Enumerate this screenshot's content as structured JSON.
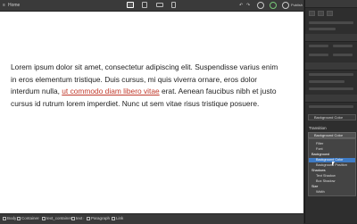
{
  "toolbar": {
    "left_label": "Home",
    "devices": [
      "desktop-icon",
      "tablet-icon",
      "phone-landscape-icon",
      "phone-icon"
    ],
    "right_label": "Publish"
  },
  "paragraph": {
    "before": "Lorem ipsum dolor sit amet, consectetur adipiscing elit. Suspendisse varius enim in eros elementum tristique. Duis cursus, mi quis viverra ornare, eros dolor interdum nulla, ",
    "link": "ut commodo diam libero vitae",
    "after": " erat. Aenean faucibus nibh et justo cursus id rutrum lorem imperdiet. Nunc ut sem vitae risus tristique posuere.",
    "link_color": "#c0392b"
  },
  "breadcrumb": {
    "items": [
      "Body",
      "Container",
      "text_container",
      "text",
      "Paragraph",
      "Link"
    ]
  },
  "panel": {
    "background_color_row": "Background Color",
    "transition_label": "Transition",
    "transition_value": "Background Color",
    "dropdown": [
      {
        "label": "Filter",
        "kind": "item"
      },
      {
        "label": "Font",
        "kind": "item"
      },
      {
        "label": "Background",
        "kind": "group"
      },
      {
        "label": "Background Color",
        "kind": "selected"
      },
      {
        "label": "Background Position",
        "kind": "item"
      },
      {
        "label": "Shadows",
        "kind": "group"
      },
      {
        "label": "Text Shadow",
        "kind": "item"
      },
      {
        "label": "Box Shadow",
        "kind": "item"
      },
      {
        "label": "Size",
        "kind": "group"
      },
      {
        "label": "Width",
        "kind": "item"
      }
    ]
  }
}
